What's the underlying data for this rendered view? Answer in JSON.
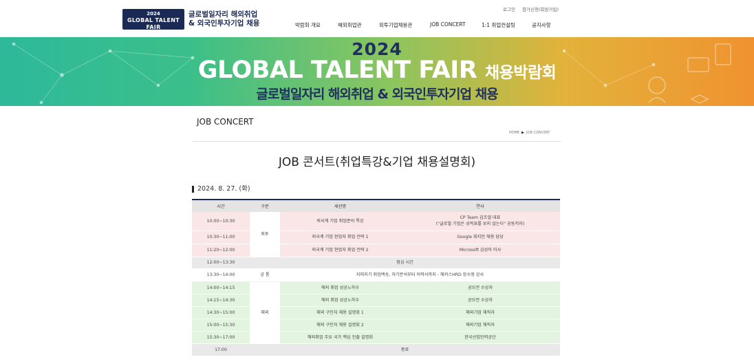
{
  "header": {
    "logo": {
      "year": "2024",
      "name": "GLOBAL TALENT FAIR",
      "sub": "채용박람회"
    },
    "logo_text_line1": "글로벌일자리 해외취업",
    "logo_text_line2": "& 외국인투자기업 채용",
    "util": {
      "login": "로그인",
      "register": "참가신청(회원가입)"
    },
    "nav": [
      "박람회 개요",
      "해외취업관",
      "외투기업채용관",
      "JOB CONCERT",
      "1:1 취업컨설팅",
      "공지사항"
    ]
  },
  "banner": {
    "year": "2024",
    "title": "GLOBAL TALENT FAIR",
    "title_suffix": "채용박람회",
    "subtitle": "글로벌일자리 해외취업 & 외국인투자기업 채용"
  },
  "page": {
    "title": "JOB CONCERT",
    "breadcrumb": {
      "home": "HOME",
      "current": "JOB CONCERT"
    },
    "main_title": "JOB 콘서트(취업특강&기업 채용설명회)",
    "date": "2024. 8. 27. (화)"
  },
  "table": {
    "headers": [
      "시간",
      "구분",
      "세션명",
      "연사"
    ],
    "groups": {
      "foreign": "외투",
      "common": "공 통",
      "overseas": "해외"
    },
    "rows": [
      {
        "time": "10:00~10:30",
        "session": "외국계 기업 취업준비 특강",
        "speaker1": "CP Team 김조엘 대표",
        "speaker2": "(\"글로벌 기업은 성적표를 보지 않는다\" 공동저자)"
      },
      {
        "time": "10:30~11:00",
        "session": "외국계 기업 현업자 취업 전략 1",
        "speaker1": "Google 최지민 채용 담당"
      },
      {
        "time": "11:20~12:00",
        "session": "외국계 기업 현업자 취업 전략 2",
        "speaker1": "Microsoft 김성미 이사"
      },
      {
        "time": "12:00~13:30",
        "merged": "점심 시간"
      },
      {
        "time": "13:30~14:00",
        "merged": "지피지기 취업백승, 자기분석부터 이력서까지 - 해커스HRD 앙수영 강사"
      },
      {
        "time": "14:00~14:15",
        "session": "해외 취업 성공노하우",
        "speaker1": "공모전 수상자"
      },
      {
        "time": "14:15~14:30",
        "session": "해외 취업 성공노하우",
        "speaker1": "공모전 수상자"
      },
      {
        "time": "14:30~15:00",
        "session": "해외 구인처 채용 설명회 1",
        "speaker1": "해외기업 채직자"
      },
      {
        "time": "15:00~15:30",
        "session": "해외 구인처 채용 설명회 2",
        "speaker1": "해외기업 채직자"
      },
      {
        "time": "15:30~17:00",
        "session": "해외취업 주요 국가 핵심 진출 설명회",
        "speaker1": "한국산업인력공단"
      },
      {
        "time": "17:00",
        "merged": "종료"
      }
    ]
  },
  "colors": {
    "navy": "#1b2a55",
    "pink_row": "#fae6e6",
    "green_row": "#e3f5e0",
    "gray_row": "#e9e9e9"
  }
}
